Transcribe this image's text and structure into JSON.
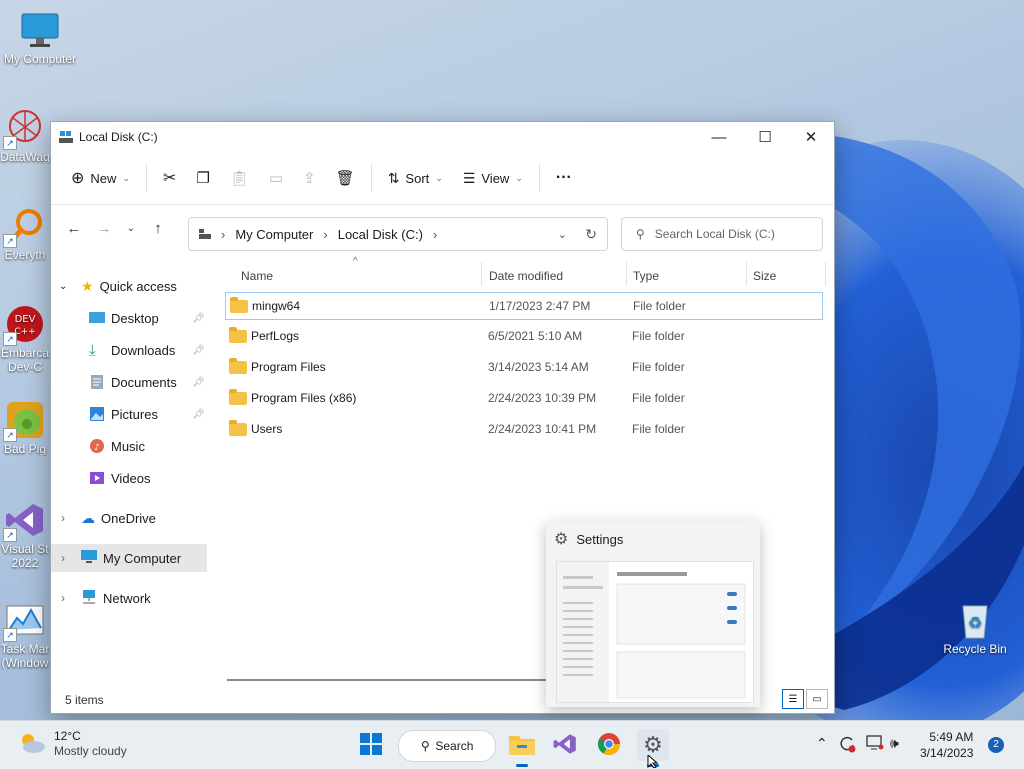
{
  "desktop": {
    "icons": [
      {
        "label": "My Computer"
      },
      {
        "label": "DataWag"
      },
      {
        "label": "Everyth"
      },
      {
        "label": "Embarca Dev-C"
      },
      {
        "label": "Bad Pig"
      },
      {
        "label": "Visual St 2022"
      },
      {
        "label": "Task Mar (Window"
      },
      {
        "label": "Recycle Bin"
      }
    ]
  },
  "window": {
    "title": "Local Disk (C:)",
    "controls": {
      "minimize": "—",
      "maximize": "☐",
      "close": "✕"
    },
    "toolbar": {
      "new_label": "New",
      "sort_label": "Sort",
      "view_label": "View",
      "more_label": "···"
    },
    "address": {
      "crumbs": [
        "My Computer",
        "Local Disk (C:)"
      ],
      "search_placeholder": "Search Local Disk (C:)"
    },
    "nav": {
      "quick_access": "Quick access",
      "items": [
        {
          "label": "Desktop",
          "pinned": true
        },
        {
          "label": "Downloads",
          "pinned": true
        },
        {
          "label": "Documents",
          "pinned": true
        },
        {
          "label": "Pictures",
          "pinned": true
        },
        {
          "label": "Music",
          "pinned": false
        },
        {
          "label": "Videos",
          "pinned": false
        }
      ],
      "onedrive": "OneDrive",
      "my_computer": "My Computer",
      "network": "Network"
    },
    "columns": {
      "name": "Name",
      "date": "Date modified",
      "type": "Type",
      "size": "Size"
    },
    "files": [
      {
        "name": "mingw64",
        "date": "1/17/2023 2:47 PM",
        "type": "File folder",
        "selected": true
      },
      {
        "name": "PerfLogs",
        "date": "6/5/2021 5:10 AM",
        "type": "File folder",
        "selected": false
      },
      {
        "name": "Program Files",
        "date": "3/14/2023 5:14 AM",
        "type": "File folder",
        "selected": false
      },
      {
        "name": "Program Files (x86)",
        "date": "2/24/2023 10:39 PM",
        "type": "File folder",
        "selected": false
      },
      {
        "name": "Users",
        "date": "2/24/2023 10:41 PM",
        "type": "File folder",
        "selected": false
      }
    ],
    "status": "5 items"
  },
  "preview": {
    "title": "Settings"
  },
  "taskbar": {
    "weather_temp": "12°C",
    "weather_desc": "Mostly cloudy",
    "search_label": "Search",
    "time": "5:49 AM",
    "date": "3/14/2023",
    "notif_count": "2"
  },
  "colors": {
    "accent": "#0067c0",
    "folder": "#f4c244",
    "selection_border": "#99c9ef"
  }
}
